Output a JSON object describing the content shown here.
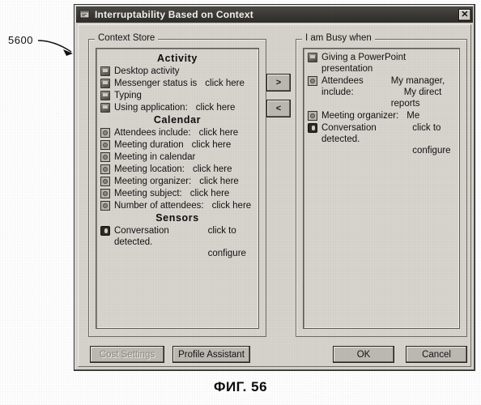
{
  "figure": {
    "caption": "ФИГ. 56",
    "reference_numeral": "5600"
  },
  "dialog": {
    "title": "Interruptability Based on Context",
    "title_icon": "app-window-icon",
    "close_label": "✕"
  },
  "context_store": {
    "legend": "Context Store",
    "sections": [
      {
        "header": "Activity",
        "items": [
          {
            "icon": "monitor-icon",
            "label": "Desktop activity",
            "action": ""
          },
          {
            "icon": "monitor-icon",
            "label": "Messenger status is",
            "action": "click here"
          },
          {
            "icon": "monitor-icon",
            "label": "Typing",
            "action": ""
          },
          {
            "icon": "monitor-icon",
            "label": "Using application:",
            "action": "click here"
          }
        ]
      },
      {
        "header": "Calendar",
        "items": [
          {
            "icon": "calendar-icon",
            "label": "Attendees include:",
            "action": "click here"
          },
          {
            "icon": "calendar-icon",
            "label": "Meeting duration",
            "action": "click here"
          },
          {
            "icon": "calendar-icon",
            "label": "Meeting in calendar",
            "action": ""
          },
          {
            "icon": "calendar-icon",
            "label": "Meeting location:",
            "action": "click here"
          },
          {
            "icon": "calendar-icon",
            "label": "Meeting organizer:",
            "action": "click here"
          },
          {
            "icon": "calendar-icon",
            "label": "Meeting subject:",
            "action": "click here"
          },
          {
            "icon": "calendar-icon",
            "label": "Number of attendees:",
            "action": "click here"
          }
        ]
      },
      {
        "header": "Sensors",
        "items": [
          {
            "icon": "microphone-icon",
            "label": "Conversation detected.",
            "action": "click to\n      configure"
          }
        ]
      }
    ]
  },
  "busy_when": {
    "legend": "I am Busy when",
    "items": [
      {
        "icon": "monitor-icon",
        "label": "Giving a PowerPoint presentation",
        "action": ""
      },
      {
        "icon": "calendar-icon",
        "label": "Attendees include:",
        "action": "My manager,\n     My direct reports"
      },
      {
        "icon": "calendar-icon",
        "label": "Meeting organizer:",
        "action": "Me"
      },
      {
        "icon": "microphone-icon",
        "label": "Conversation detected.",
        "action": "click to\n     configure"
      }
    ]
  },
  "transfer": {
    "add_label": ">",
    "remove_label": "<"
  },
  "footer": {
    "cost_settings": "Cost Settings",
    "profile_assistant": "Profile Assistant",
    "ok": "OK",
    "cancel": "Cancel"
  }
}
